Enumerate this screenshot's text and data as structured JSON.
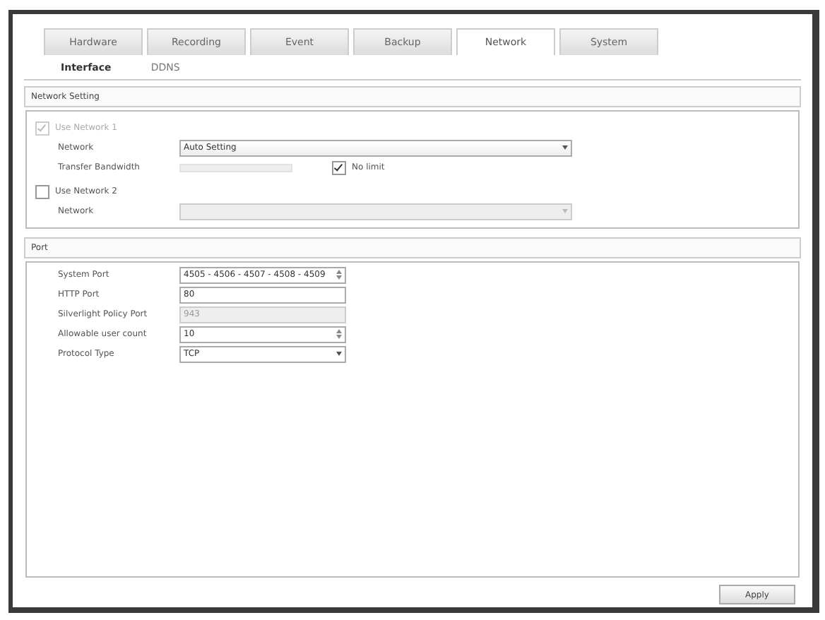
{
  "tabs": [
    {
      "label": "Hardware",
      "selected": false
    },
    {
      "label": "Recording",
      "selected": false
    },
    {
      "label": "Event",
      "selected": false
    },
    {
      "label": "Backup",
      "selected": false
    },
    {
      "label": "Network",
      "selected": true
    },
    {
      "label": "System",
      "selected": false
    }
  ],
  "subtabs": [
    {
      "label": "Interface",
      "selected": true
    },
    {
      "label": "DDNS",
      "selected": false
    }
  ],
  "sections": [
    {
      "title": "Network Setting",
      "rows": [
        {
          "kind": "checkbox",
          "label": "Use Network 1",
          "checked": true,
          "disabled": true
        },
        {
          "kind": "select",
          "label": "Network",
          "value": "Auto Setting",
          "disabled": false,
          "wide": true
        },
        {
          "kind": "slider",
          "label": "Transfer Bandwidth",
          "option": "No limit",
          "checked": true
        },
        {
          "kind": "checkbox",
          "label": "Use Network 2",
          "checked": false,
          "disabled": false
        },
        {
          "kind": "select",
          "label": "Network",
          "disabled": true,
          "wide": true
        }
      ]
    },
    {
      "title": "Port",
      "rows": [
        {
          "kind": "spin",
          "label": "System Port",
          "value": "4505 - 4506 - 4507 - 4508 - 4509",
          "disabled": false
        },
        {
          "kind": "text",
          "label": "HTTP Port",
          "value": "80",
          "disabled": false
        },
        {
          "kind": "text",
          "label": "Silverlight Policy Port",
          "value": "943",
          "disabled": true
        },
        {
          "kind": "spin",
          "label": "Allowable user count",
          "value": "10",
          "disabled": false
        },
        {
          "kind": "select",
          "label": "Protocol Type",
          "value": "TCP",
          "disabled": false,
          "wide": false
        }
      ]
    }
  ],
  "apply_button": "Apply"
}
